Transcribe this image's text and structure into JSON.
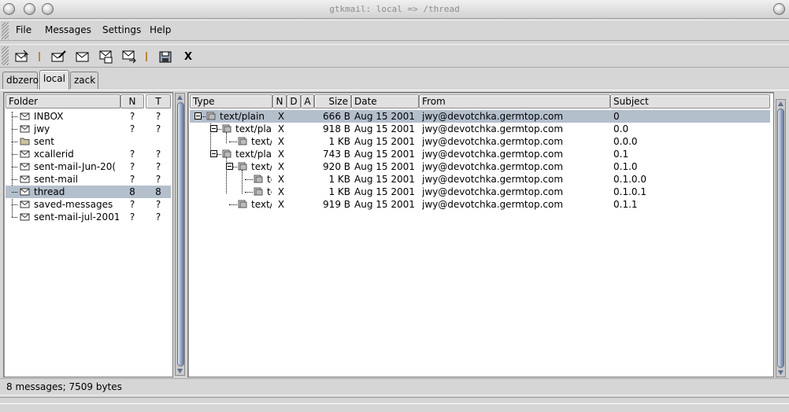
{
  "window": {
    "title": "gtkmail: local => /thread",
    "buttons": [
      "close",
      "minimize",
      "maximize"
    ]
  },
  "menu": {
    "file": "File",
    "messages": "Messages",
    "settings": "Settings",
    "help": "Help"
  },
  "toolbar": {
    "icons": [
      "check-mail-icon",
      "compose-icon",
      "reply-icon",
      "reply-all-icon",
      "forward-icon",
      "save-icon",
      "delete-icon"
    ],
    "delete_label": "X"
  },
  "tabs": [
    {
      "label": "dbzero"
    },
    {
      "label": "local",
      "active": true
    },
    {
      "label": "zack"
    }
  ],
  "folders": {
    "headers": {
      "folder": "Folder",
      "n": "N",
      "t": "T"
    },
    "rows": [
      {
        "name": "INBOX",
        "n": "?",
        "t": "?"
      },
      {
        "name": "jwy",
        "n": "?",
        "t": "?"
      },
      {
        "name": "sent",
        "n": "",
        "t": ""
      },
      {
        "name": "xcallerid",
        "n": "?",
        "t": "?"
      },
      {
        "name": "sent-mail-Jun-20(",
        "n": "?",
        "t": "?"
      },
      {
        "name": "sent-mail",
        "n": "?",
        "t": "?"
      },
      {
        "name": "thread",
        "n": "8",
        "t": "8",
        "selected": true
      },
      {
        "name": "saved-messages",
        "n": "?",
        "t": "?"
      },
      {
        "name": "sent-mail-jul-2001",
        "n": "?",
        "t": "?"
      }
    ]
  },
  "messages": {
    "headers": {
      "type": "Type",
      "n": "N",
      "d": "D",
      "a": "A",
      "size": "Size",
      "date": "Date",
      "from": "From",
      "subject": "Subject"
    },
    "rows": [
      {
        "type": "text/plain",
        "n": "X",
        "size": "666 B",
        "date": "Aug 15 2001",
        "from": "jwy@devotchka.germtop.com",
        "subject": "0",
        "selected": true
      },
      {
        "type": "text/plair",
        "n": "X",
        "size": "918 B",
        "date": "Aug 15 2001",
        "from": "jwy@devotchka.germtop.com",
        "subject": "0.0"
      },
      {
        "type": "text/p",
        "n": "X",
        "size": "1 KB",
        "date": "Aug 15 2001",
        "from": "jwy@devotchka.germtop.com",
        "subject": "0.0.0"
      },
      {
        "type": "text/plair",
        "n": "X",
        "size": "743 B",
        "date": "Aug 15 2001",
        "from": "jwy@devotchka.germtop.com",
        "subject": "0.1"
      },
      {
        "type": "text/p",
        "n": "X",
        "size": "920 B",
        "date": "Aug 15 2001",
        "from": "jwy@devotchka.germtop.com",
        "subject": "0.1.0"
      },
      {
        "type": "te",
        "n": "X",
        "size": "1 KB",
        "date": "Aug 15 2001",
        "from": "jwy@devotchka.germtop.com",
        "subject": "0.1.0.0"
      },
      {
        "type": "te",
        "n": "X",
        "size": "1 KB",
        "date": "Aug 15 2001",
        "from": "jwy@devotchka.germtop.com",
        "subject": "0.1.0.1"
      },
      {
        "type": "text/p",
        "n": "X",
        "size": "919 B",
        "date": "Aug 15 2001",
        "from": "jwy@devotchka.germtop.com",
        "subject": "0.1.1"
      }
    ]
  },
  "status": {
    "text": "8 messages; 7509 bytes"
  },
  "colors": {
    "selection": "#b4bfcc",
    "scroll_thumb": "#8e9fbd",
    "separator": "#b88a3a"
  }
}
